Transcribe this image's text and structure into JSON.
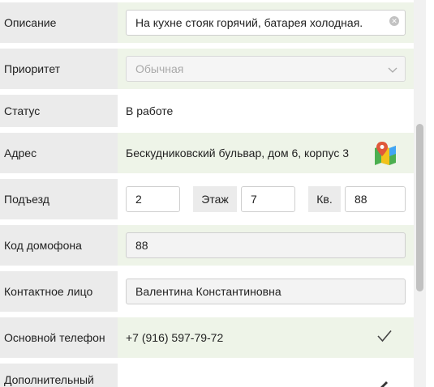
{
  "fields": {
    "description": {
      "label": "Описание",
      "value": "На кухне стояк горячий, батарея холодная."
    },
    "priority": {
      "label": "Приоритет",
      "placeholder": "Обычная"
    },
    "status": {
      "label": "Статус",
      "value": "В работе"
    },
    "address": {
      "label": "Адрес",
      "value": "Бескудниковский бульвар, дом 6, корпус 3"
    },
    "entrance": {
      "label": "Подъезд",
      "value": "2",
      "floor_label": "Этаж",
      "floor_value": "7",
      "apartment_label": "Кв.",
      "apartment_value": "88"
    },
    "intercom": {
      "label": "Код домофона",
      "value": "88"
    },
    "contact": {
      "label": "Контактное лицо",
      "value": "Валентина Константиновна"
    },
    "main_phone": {
      "label": "Основной телефон",
      "value": "+7 (916) 597-79-72"
    },
    "extra_phone": {
      "label": "Дополнительный"
    }
  },
  "icons": {
    "clear": "clear-icon",
    "dropdown": "chevron-down-icon",
    "map": "map-icon",
    "confirmed": "checkmark-icon",
    "edit": "pencil-icon"
  },
  "colors": {
    "label_bg": "#ebebeb",
    "highlight_bg": "#eef4e8",
    "map_pin": "#e0573a",
    "map_green": "#4caf50",
    "map_yellow": "#f2c21b"
  }
}
